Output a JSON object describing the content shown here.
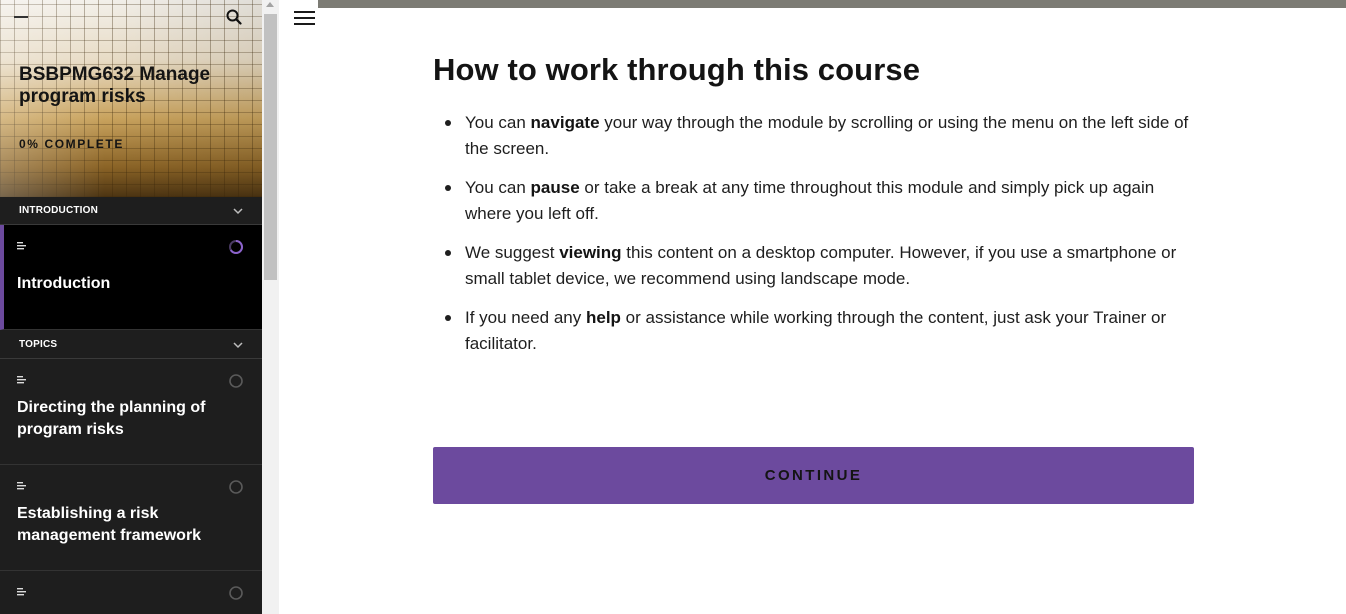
{
  "sidebar": {
    "course_title": "BSBPMG632 Manage program risks",
    "progress_text": "0% COMPLETE",
    "sections": [
      {
        "label": "INTRODUCTION"
      },
      {
        "label": "TOPICS"
      }
    ],
    "lessons": [
      {
        "title": "Introduction",
        "status": "in-progress"
      },
      {
        "title": "Directing the planning of program risks",
        "status": "not-started"
      },
      {
        "title": "Establishing a risk management framework",
        "status": "not-started"
      },
      {
        "title": "",
        "status": "not-started"
      }
    ]
  },
  "main": {
    "title": "How to work through this course",
    "bullets": [
      {
        "pre": "You can ",
        "bold": "navigate",
        "post": " your way through the module by scrolling or using the menu on the left side of the screen."
      },
      {
        "pre": "You can ",
        "bold": "pause",
        "post": " or take a break at any time throughout this module and simply pick up again where you left off."
      },
      {
        "pre": "We suggest ",
        "bold": "viewing",
        "post": " this content on a desktop computer. However, if you use a smartphone or small tablet device, we recommend using landscape mode."
      },
      {
        "pre": "If you need any ",
        "bold": "help",
        "post": " or assistance while working through the content, just ask your Trainer or facilitator."
      }
    ],
    "continue_label": "CONTINUE"
  },
  "icons": {
    "search": "search-icon",
    "menu": "hamburger-menu-icon",
    "chevron": "chevron-down-icon",
    "lesson": "text-lines-icon",
    "status": "progress-circle-icon"
  },
  "colors": {
    "accent": "#6c4a9e",
    "sidebar_bg": "#1e1e1e",
    "active_lesson_bg": "#000000",
    "topbar": "#7c7b74"
  }
}
